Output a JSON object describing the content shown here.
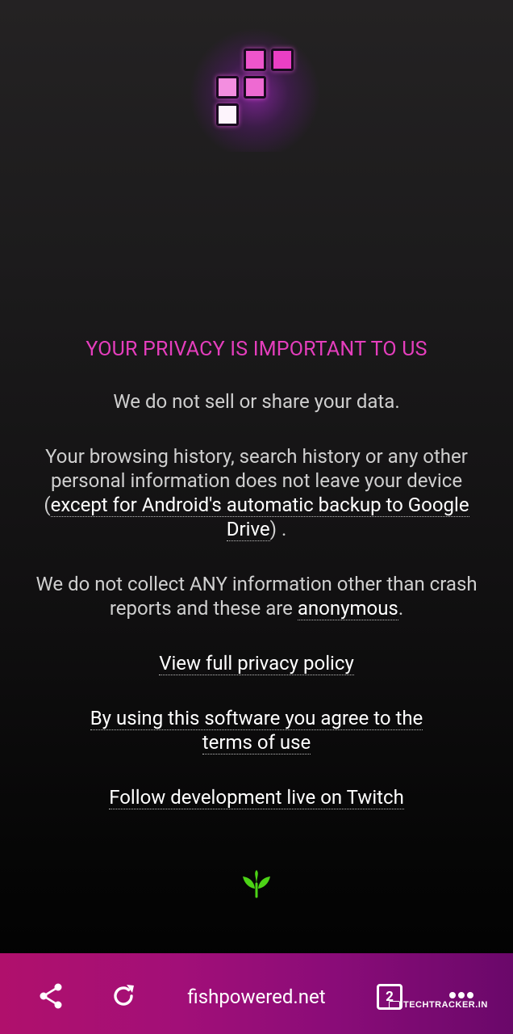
{
  "privacy": {
    "heading": "YOUR PRIVACY IS IMPORTANT TO US",
    "no_sell": "We do not sell or share your data.",
    "history_pre": "Your browsing history, search history or any other personal information does not leave your device (",
    "history_link": "except for Android's automatic backup to Google Drive",
    "history_post": ") .",
    "collect_pre": "We do not collect ANY information other than crash reports and these are ",
    "collect_link": "anonymous",
    "collect_post": ".",
    "policy_link": "View full privacy policy",
    "terms_link_1": "By using this software you agree to the",
    "terms_link_2": "terms of use",
    "twitch_link": "Follow development live on Twitch"
  },
  "bottom_bar": {
    "url": "fishpowered.net",
    "tab_count": "2",
    "icons": [
      "share-icon",
      "reload-icon",
      "tabs-icon",
      "more-icon"
    ]
  },
  "watermark": "TECHTRACKER.IN",
  "colors": {
    "accent": "#e53ebd",
    "sprout": "#4cd316",
    "bar_start": "#b0106c",
    "bar_end": "#6a086a"
  }
}
